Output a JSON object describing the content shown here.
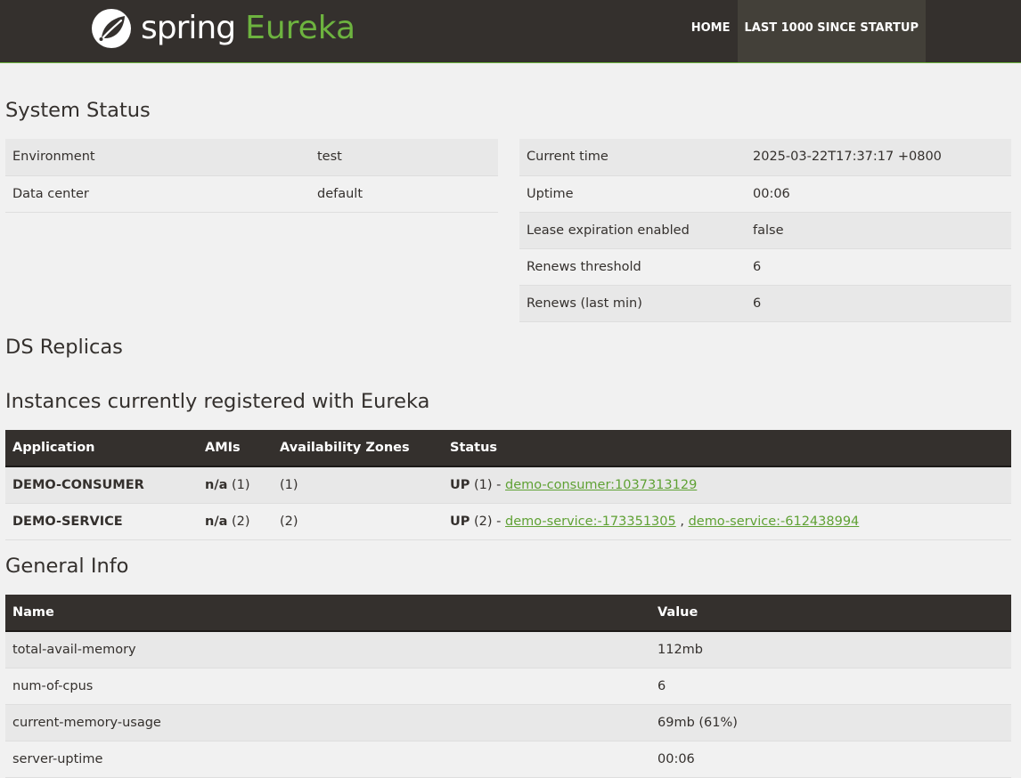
{
  "nav": {
    "brand_spring": "spring",
    "brand_eureka": "Eureka",
    "home": "HOME",
    "last1000": "LAST 1000 SINCE STARTUP"
  },
  "system_status": {
    "title": "System Status",
    "left": [
      {
        "label": "Environment",
        "value": "test"
      },
      {
        "label": "Data center",
        "value": "default"
      }
    ],
    "right": [
      {
        "label": "Current time",
        "value": "2025-03-22T17:37:17 +0800"
      },
      {
        "label": "Uptime",
        "value": "00:06"
      },
      {
        "label": "Lease expiration enabled",
        "value": "false"
      },
      {
        "label": "Renews threshold",
        "value": "6"
      },
      {
        "label": "Renews (last min)",
        "value": "6"
      }
    ]
  },
  "ds_replicas": {
    "title": "DS Replicas"
  },
  "instances": {
    "title": "Instances currently registered with Eureka",
    "headers": [
      "Application",
      "AMIs",
      "Availability Zones",
      "Status"
    ],
    "rows": [
      {
        "application": "DEMO-CONSUMER",
        "amis_bold": "n/a",
        "amis_count": "(1)",
        "zones": "(1)",
        "status_bold": "UP",
        "status_count": "(1) - ",
        "links": [
          "demo-consumer:1037313129"
        ]
      },
      {
        "application": "DEMO-SERVICE",
        "amis_bold": "n/a",
        "amis_count": "(2)",
        "zones": "(2)",
        "status_bold": "UP",
        "status_count": "(2) - ",
        "links": [
          "demo-service:-173351305",
          "demo-service:-612438994"
        ],
        "link_separator": " , "
      }
    ]
  },
  "general_info": {
    "title": "General Info",
    "headers": [
      "Name",
      "Value"
    ],
    "rows": [
      {
        "name": "total-avail-memory",
        "value": "112mb"
      },
      {
        "name": "num-of-cpus",
        "value": "6"
      },
      {
        "name": "current-memory-usage",
        "value": "69mb (61%)"
      },
      {
        "name": "server-uptime",
        "value": "00:06"
      }
    ]
  },
  "colors": {
    "nav_bg": "#34302d",
    "accent": "#6db33f",
    "link": "#5fa134",
    "page_bg": "#f1f1f1",
    "row_odd": "#e8e8e8"
  }
}
